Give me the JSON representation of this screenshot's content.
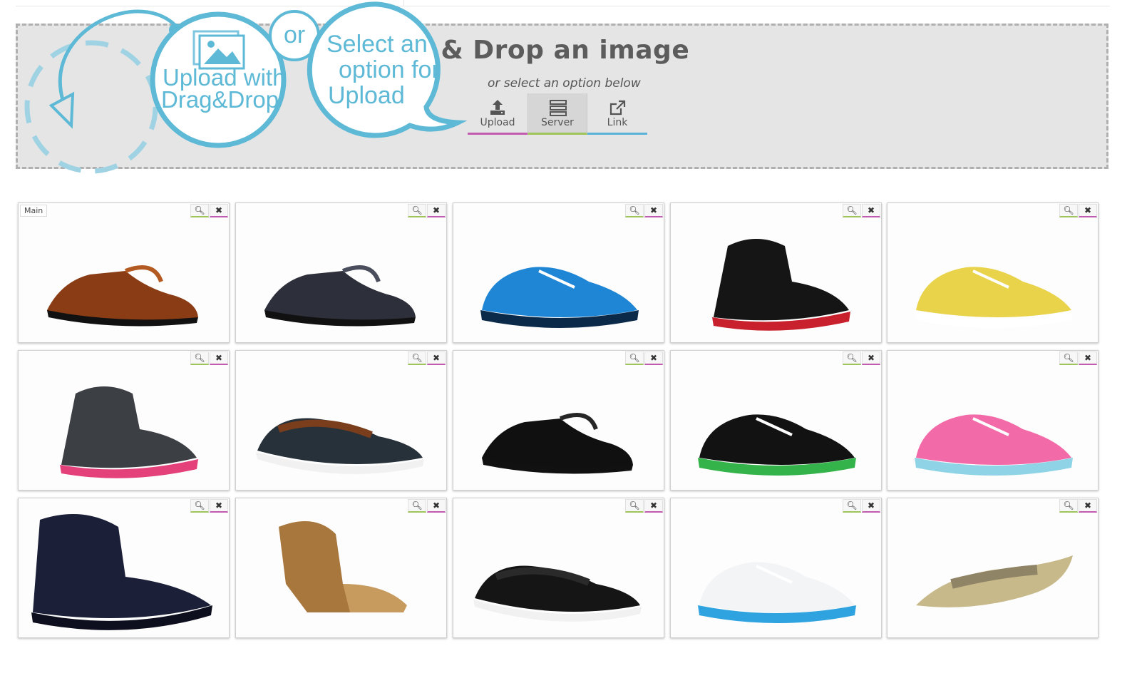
{
  "dropzone": {
    "title": "rag & Drop an image",
    "subtitle": "or select an option below",
    "options": [
      {
        "label": "Upload",
        "icon": "upload-icon",
        "accent": "#c15bb0"
      },
      {
        "label": "Server",
        "icon": "server-icon",
        "accent": "#9fc45b"
      },
      {
        "label": "Link",
        "icon": "external-link-icon",
        "accent": "#5bb2d6"
      }
    ]
  },
  "callout": {
    "left_line1": "Upload with",
    "left_line2": "Drag&Drop",
    "or": "or",
    "right_line1": "Select an",
    "right_line2": "option for",
    "right_line3": "Upload",
    "color": "#5db9d6"
  },
  "gallery": {
    "main_badge": "Main",
    "items": [
      {
        "name": "brown leather oxford shoes",
        "kind": "dress",
        "colors": [
          "#8a3c14",
          "#b35a22"
        ]
      },
      {
        "name": "dark blue patent oxford shoes",
        "kind": "dress",
        "colors": [
          "#2d2f3a",
          "#4a4d5c"
        ]
      },
      {
        "name": "blue sneakers",
        "kind": "sneaker",
        "colors": [
          "#1f86d6",
          "#0b2a4a"
        ]
      },
      {
        "name": "black red high-top sneakers",
        "kind": "hightop",
        "colors": [
          "#151515",
          "#c8202c"
        ]
      },
      {
        "name": "colorful printed sneakers",
        "kind": "sneaker",
        "colors": [
          "#e8d34a",
          "#ffffff"
        ]
      },
      {
        "name": "grey pink high-top sneakers",
        "kind": "hightop",
        "colors": [
          "#3c3f44",
          "#e4407a"
        ]
      },
      {
        "name": "brown boat shoes",
        "kind": "boat",
        "colors": [
          "#27313a",
          "#7a3e1c"
        ]
      },
      {
        "name": "black suede creepers",
        "kind": "dress",
        "colors": [
          "#101010",
          "#262626"
        ]
      },
      {
        "name": "black running shoes",
        "kind": "sneaker",
        "colors": [
          "#121212",
          "#34b34a"
        ]
      },
      {
        "name": "pink running shoes",
        "kind": "sneaker",
        "colors": [
          "#f26aa8",
          "#8ed4e6"
        ]
      },
      {
        "name": "navy work boots",
        "kind": "boot",
        "colors": [
          "#1b1f38",
          "#2a2f52"
        ]
      },
      {
        "name": "tan suede wedge bootie",
        "kind": "bootie",
        "colors": [
          "#a8773e",
          "#c79a5e"
        ]
      },
      {
        "name": "black boat shoes",
        "kind": "boat",
        "colors": [
          "#151515",
          "#2a2a2a"
        ]
      },
      {
        "name": "white blue running shoes",
        "kind": "sneaker",
        "colors": [
          "#f2f4f6",
          "#2ea3e0"
        ]
      },
      {
        "name": "gold ankle strap flats",
        "kind": "flat",
        "colors": [
          "#c8b98a",
          "#8f8466"
        ]
      }
    ]
  }
}
